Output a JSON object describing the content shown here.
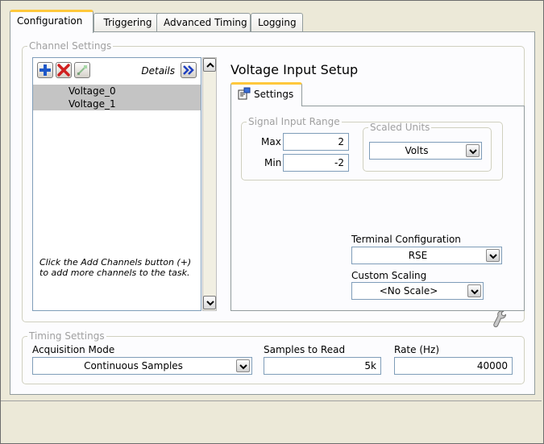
{
  "tabs": [
    {
      "label": "Configuration",
      "active": true
    },
    {
      "label": "Triggering",
      "active": false
    },
    {
      "label": "Advanced Timing",
      "active": false
    },
    {
      "label": "Logging",
      "active": false
    }
  ],
  "channel_settings": {
    "legend": "Channel Settings",
    "details_label": "Details",
    "channels": [
      "Voltage_0",
      "Voltage_1"
    ],
    "hint": "Click the Add Channels button (+) to add more channels to the task.",
    "icons": {
      "add": "plus-icon",
      "remove": "x-icon",
      "props": "channel-props-icon",
      "details": "double-chevron-right-icon"
    }
  },
  "voltage_setup": {
    "title": "Voltage Input Setup",
    "settings_tab": "Settings",
    "signal_input_range": {
      "legend": "Signal Input Range",
      "max_label": "Max",
      "max_value": "2",
      "min_label": "Min",
      "min_value": "-2"
    },
    "scaled_units": {
      "legend": "Scaled Units",
      "value": "Volts"
    },
    "terminal_configuration": {
      "label": "Terminal Configuration",
      "value": "RSE"
    },
    "custom_scaling": {
      "label": "Custom Scaling",
      "value": "<No Scale>"
    }
  },
  "timing_settings": {
    "legend": "Timing Settings",
    "acquisition_mode": {
      "label": "Acquisition Mode",
      "value": "Continuous Samples"
    },
    "samples_to_read": {
      "label": "Samples to Read",
      "value": "5k"
    },
    "rate": {
      "label": "Rate (Hz)",
      "value": "40000"
    }
  },
  "colors": {
    "tab_highlight": "#ffc83c",
    "selected_row": "#c4c4c4",
    "add_icon": "#1f58c8",
    "remove_icon": "#d02020",
    "details_icon": "#1f3fc0"
  }
}
